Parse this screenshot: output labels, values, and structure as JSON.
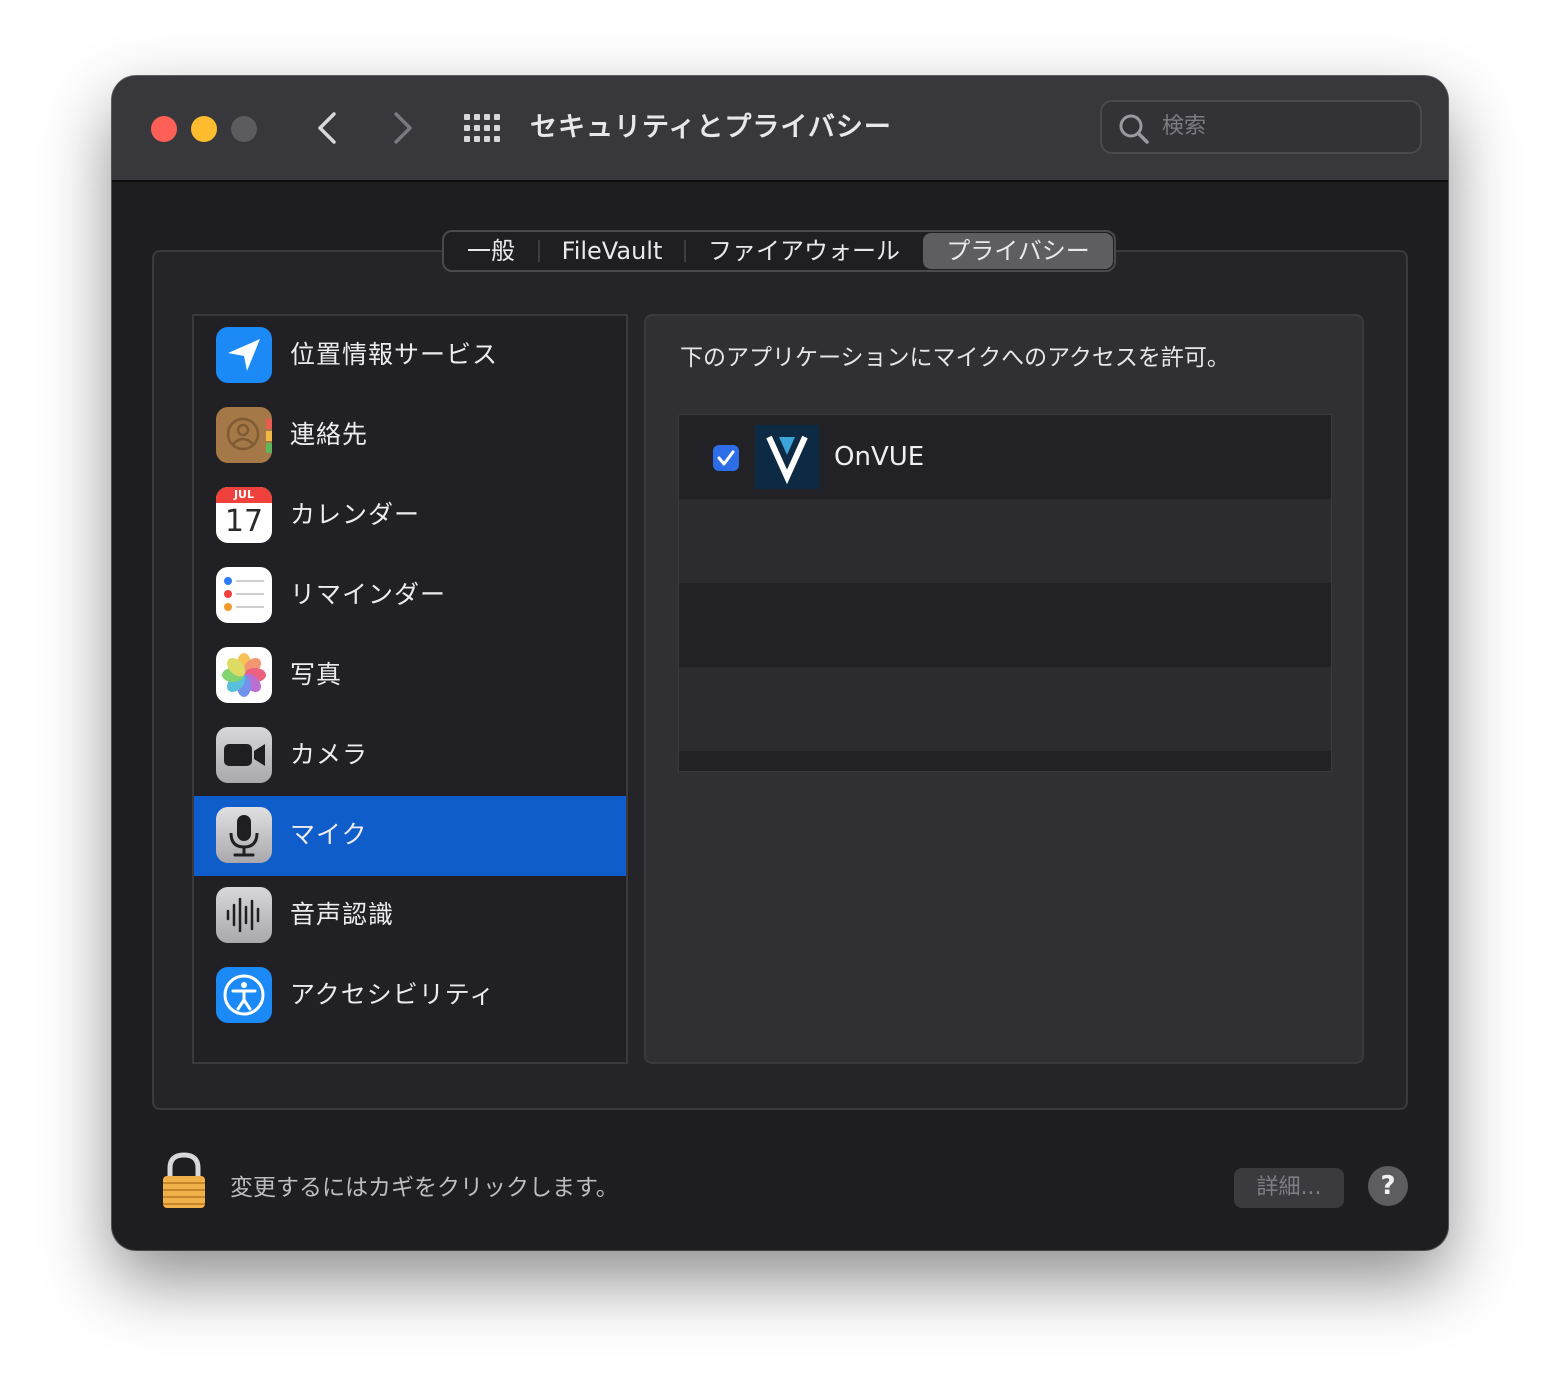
{
  "window": {
    "title": "セキュリティとプライバシー",
    "search_placeholder": "検索"
  },
  "tabs": [
    {
      "label": "一般",
      "selected": false
    },
    {
      "label": "FileVault",
      "selected": false
    },
    {
      "label": "ファイアウォール",
      "selected": false
    },
    {
      "label": "プライバシー",
      "selected": true
    }
  ],
  "sidebar": {
    "items": [
      {
        "label": "位置情報サービス",
        "icon": "location-arrow-icon",
        "selected": false
      },
      {
        "label": "連絡先",
        "icon": "contacts-icon",
        "selected": false
      },
      {
        "label": "カレンダー",
        "icon": "calendar-icon",
        "selected": false,
        "calendar_month": "JUL",
        "calendar_day": "17"
      },
      {
        "label": "リマインダー",
        "icon": "reminders-icon",
        "selected": false
      },
      {
        "label": "写真",
        "icon": "photos-icon",
        "selected": false
      },
      {
        "label": "カメラ",
        "icon": "camera-icon",
        "selected": false
      },
      {
        "label": "マイク",
        "icon": "microphone-icon",
        "selected": true
      },
      {
        "label": "音声認識",
        "icon": "speech-recognition-icon",
        "selected": false
      },
      {
        "label": "アクセシビリティ",
        "icon": "accessibility-icon",
        "selected": false
      }
    ]
  },
  "content": {
    "description": "下のアプリケーションにマイクへのアクセスを許可。",
    "apps": [
      {
        "name": "OnVUE",
        "checked": true,
        "icon": "onvue-app-icon"
      }
    ]
  },
  "footer": {
    "lock_text": "変更するにはカギをクリックします。",
    "details_label": "詳細...",
    "help_label": "?"
  },
  "colors": {
    "selection": "#0f5ccb",
    "checkbox": "#2d6ee8",
    "close": "#fe5f57",
    "minimize": "#febc2e"
  }
}
